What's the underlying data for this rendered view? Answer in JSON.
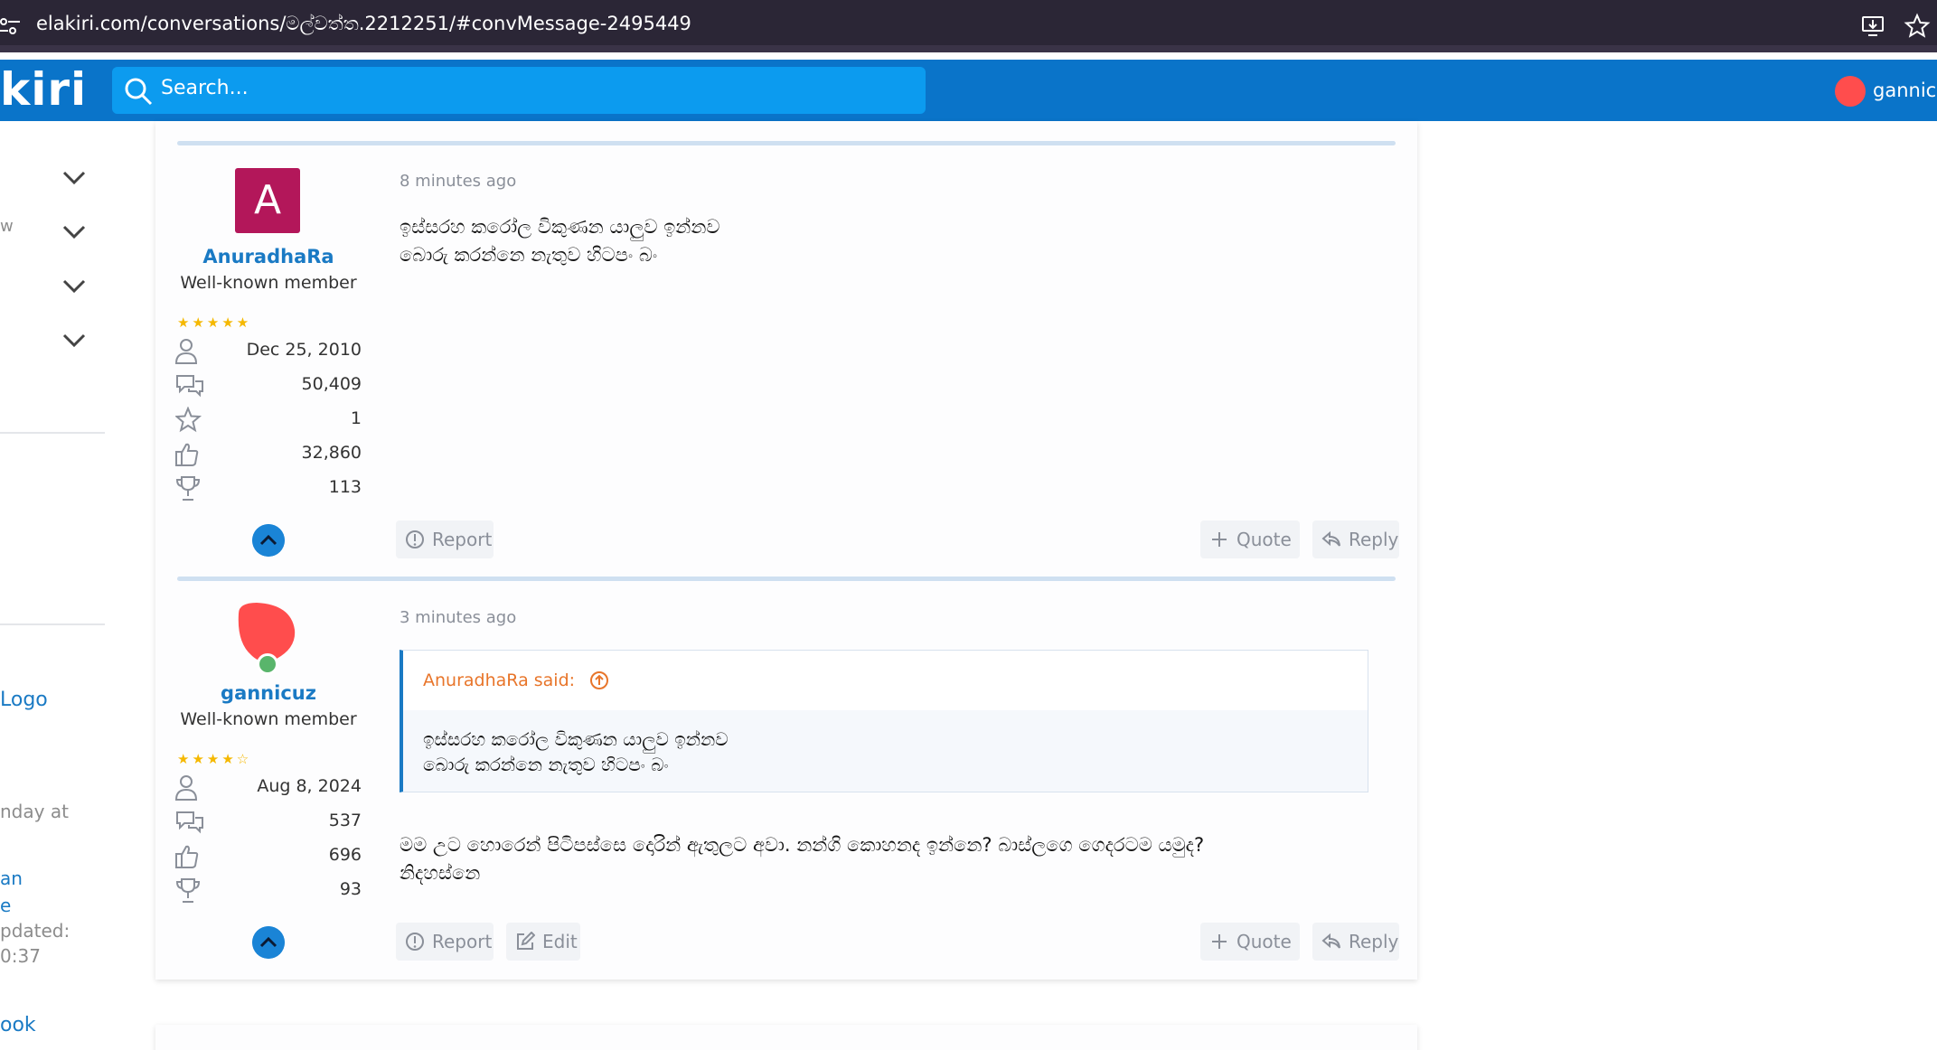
{
  "browser": {
    "url": "elakiri.com/conversations/මල්වත්ත.2212251/#convMessage-2495449"
  },
  "header": {
    "logo": "kiri",
    "search_placeholder": "Search...",
    "username": "gannicu"
  },
  "sidebar": {
    "texts": [
      "w",
      "Logo",
      "nday at",
      "an",
      "e",
      "pdated:",
      "0:37",
      "ook"
    ]
  },
  "messages": [
    {
      "avatar_letter": "A",
      "username": "AnuradhaRa",
      "user_title": "Well-known member",
      "stars": "★★★★★",
      "stats": [
        "Dec 25, 2010",
        "50,409",
        "1",
        "32,860",
        "113"
      ],
      "time": "8 minutes ago",
      "body": [
        "ඉස්සරහ කරෝල විකුණන යාලුව ඉන්නව",
        "බොරු කරන්නෙ නැතුව හිටපං බං"
      ],
      "actions": {
        "report": "Report",
        "quote": "Quote",
        "reply": "Reply"
      }
    },
    {
      "username": "gannicuz",
      "user_title": "Well-known member",
      "stars": "★★★★☆",
      "stats": [
        "Aug 8, 2024",
        "537",
        "696",
        "93"
      ],
      "time": "3 minutes ago",
      "quote": {
        "author": "AnuradhaRa said:",
        "lines": [
          "ඉස්සරහ කරෝල විකුණන යාලුව ඉන්නව",
          "බොරු කරන්නෙ නැතුව හිටපං බං"
        ]
      },
      "body": [
        "මම උට හොරෙන් පිටිපස්සෙ දොරින් ඇතුලට අවා. නන්ගි කොහනද ඉන්නෙ? බාස්ලගෙ ගෙදරටම යමුද?",
        "නිදහස්නෙ"
      ],
      "actions": {
        "report": "Report",
        "edit": "Edit",
        "quote": "Quote",
        "reply": "Reply"
      }
    }
  ]
}
